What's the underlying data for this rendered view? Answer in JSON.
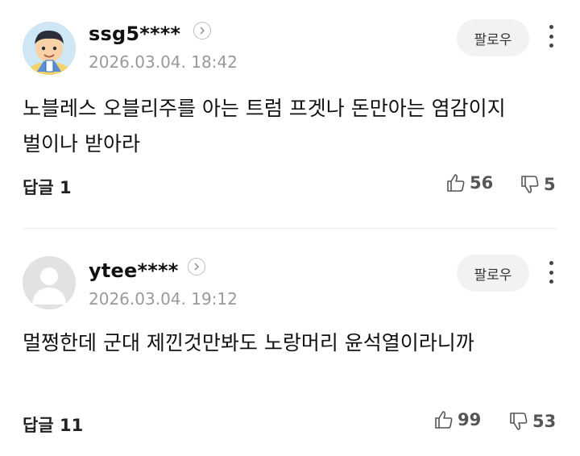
{
  "comments": [
    {
      "username": "ssg5****",
      "timestamp": "2026.03.04. 18:42",
      "follow_label": "팔로우",
      "body": "노블레스 오블리주를 아는 트럼 프겟나 돈만아는 염감이지 벌이나 받아라",
      "reply_label": "답글 1",
      "likes": "56",
      "dislikes": "5"
    },
    {
      "username": "ytee****",
      "timestamp": "2026.03.04. 19:12",
      "follow_label": "팔로우",
      "body": "멀쩡한데 군대 제낀것만봐도 노랑머리 윤석열이라니까",
      "reply_label": "답글 11",
      "likes": "99",
      "dislikes": "53"
    }
  ],
  "colors": {
    "text": "#111111",
    "muted": "#9a9a9a",
    "button_bg": "#f2f2f4",
    "divider": "#ececec"
  },
  "icons": {
    "chevron": "chevron-right-icon",
    "more": "more-vertical-icon",
    "like": "thumbs-up-icon",
    "dislike": "thumbs-down-icon"
  }
}
